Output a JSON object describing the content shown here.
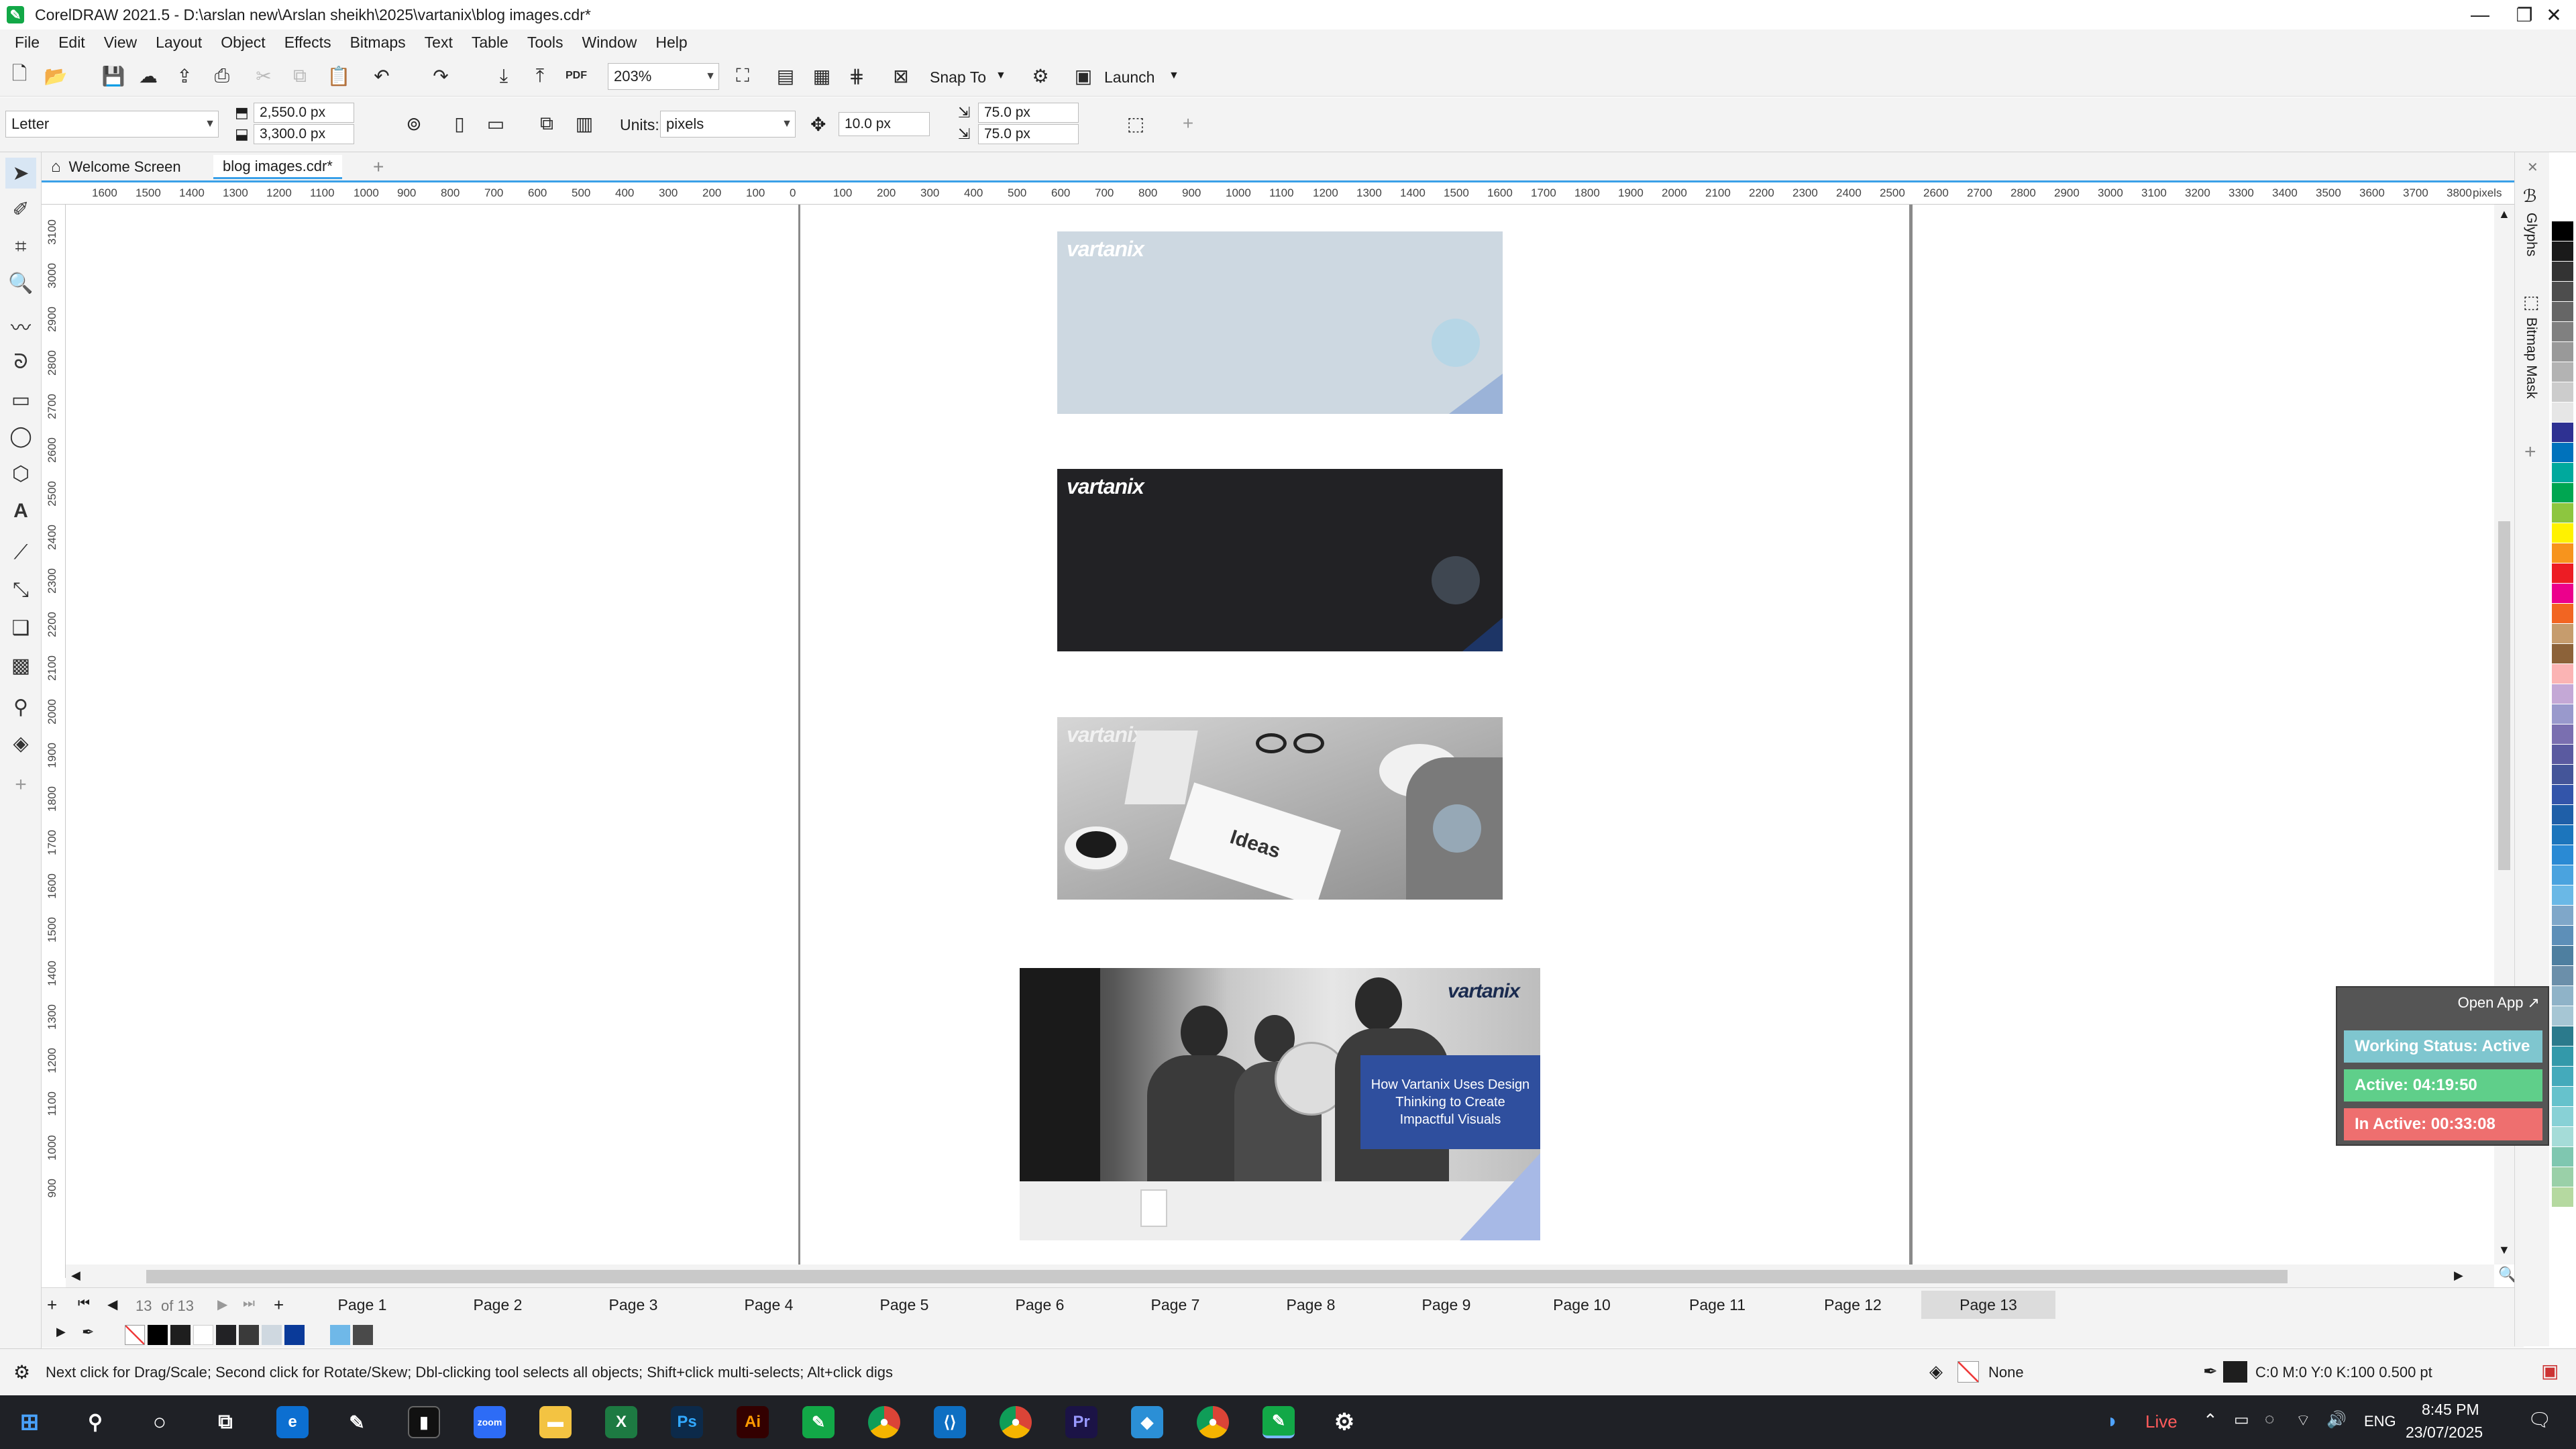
{
  "window": {
    "title": "CorelDRAW 2021.5 - D:\\arslan new\\Arslan sheikh\\2025\\vartanix\\blog images.cdr*",
    "minimize": "—",
    "maximize": "❐",
    "close": "✕"
  },
  "menu": [
    "File",
    "Edit",
    "View",
    "Layout",
    "Object",
    "Effects",
    "Bitmaps",
    "Text",
    "Table",
    "Tools",
    "Window",
    "Help"
  ],
  "standard_toolbar": {
    "zoom": "203%",
    "snap_to": "Snap To",
    "launch": "Launch",
    "pdf_label": "PDF"
  },
  "property_bar": {
    "page_size": "Letter",
    "width": "2,550.0 px",
    "height": "3,300.0 px",
    "units_label": "Units:",
    "units": "pixels",
    "nudge": "10.0 px",
    "dup_x": "75.0 px",
    "dup_y": "75.0 px"
  },
  "doc_tabs": {
    "welcome": "Welcome Screen",
    "active": "blog images.cdr*",
    "add": "+"
  },
  "ruler": {
    "h_ticks": [
      "1600",
      "1500",
      "1400",
      "1300",
      "1200",
      "1100",
      "1000",
      "900",
      "800",
      "700",
      "600",
      "500",
      "400",
      "300",
      "200",
      "100",
      "0",
      "100",
      "200",
      "300",
      "400",
      "500",
      "600",
      "700",
      "800",
      "900",
      "1000",
      "1100",
      "1200",
      "1300",
      "1400",
      "1500",
      "1600",
      "1700",
      "1800",
      "1900",
      "2000",
      "2100",
      "2200",
      "2300",
      "2400",
      "2500",
      "2600",
      "2700",
      "2800",
      "2900",
      "3000",
      "3100",
      "3200",
      "3300",
      "3400",
      "3500",
      "3600",
      "3700",
      "3800"
    ],
    "v_ticks": [
      "3100",
      "3000",
      "2900",
      "2800",
      "2700",
      "2600",
      "2500",
      "2400",
      "2300",
      "2200",
      "2100",
      "2000",
      "1900",
      "1800",
      "1700",
      "1600",
      "1500",
      "1400",
      "1300",
      "1200",
      "1100",
      "1000",
      "900"
    ],
    "unit": "pixels"
  },
  "canvas": {
    "logo": "vartanix",
    "banner_text": "How Vartanix Uses Design Thinking to Create Impactful Visuals",
    "ideas_text": "Ideas"
  },
  "page_nav": {
    "current": "13",
    "of_label": "of 13",
    "add": "+",
    "pages": [
      "Page 1",
      "Page 2",
      "Page 3",
      "Page 4",
      "Page 5",
      "Page 6",
      "Page 7",
      "Page 8",
      "Page 9",
      "Page 10",
      "Page 11",
      "Page 12",
      "Page 13"
    ],
    "active_page": "Page 13"
  },
  "dockers": [
    "Glyphs",
    "Bitmap Mask"
  ],
  "status": {
    "hint": "Next click for Drag/Scale; Second click for Rotate/Skew; Dbl-clicking tool selects all objects; Shift+click multi-selects; Alt+click digs",
    "fill": "None",
    "outline": "C:0 M:0 Y:0 K:100  0.500 pt"
  },
  "tracker": {
    "open_app": "Open App ↗",
    "working": "Working Status: Active",
    "active": "Active: 04:19:50",
    "inactive": "In Active: 00:33:08",
    "colors": {
      "working": "#7fc6cf",
      "active": "#5fcf8a",
      "inactive": "#ee6f6f"
    }
  },
  "taskbar": {
    "time": "8:45 PM",
    "date": "23/07/2025",
    "lang": "ENG",
    "live": "Live",
    "apps": [
      "zoom",
      "Ps",
      "Ai",
      "Pr"
    ]
  },
  "palette": [
    "#ffffff",
    "#000000",
    "#1a1a1a",
    "#333333",
    "#4d4d4d",
    "#666666",
    "#808080",
    "#999999",
    "#b3b3b3",
    "#cccccc",
    "#e6e6e6",
    "#2e3192",
    "#0072bc",
    "#00a99d",
    "#00a651",
    "#8dc63f",
    "#fff200",
    "#f7941d",
    "#ed1c24",
    "#ec008c",
    "#f26522",
    "#c69c6d",
    "#8c6239",
    "#fbb4b4",
    "#c4a8d6",
    "#9999cc",
    "#7a6fb0",
    "#5a5aa0",
    "#445599",
    "#3355aa",
    "#1f5fa8",
    "#1c75bc",
    "#2a8ad4",
    "#4aa3df",
    "#6ab8e6",
    "#7fa7c9",
    "#5d8fb8",
    "#4e7fa0",
    "#6b8faa",
    "#8fb3c8",
    "#a6c6d4",
    "#2b7a8c",
    "#3399aa",
    "#44aabb",
    "#66c2cc",
    "#88d1d6",
    "#a5dcd8",
    "#7fc7b0",
    "#9ad0a8",
    "#b5d9a0"
  ]
}
